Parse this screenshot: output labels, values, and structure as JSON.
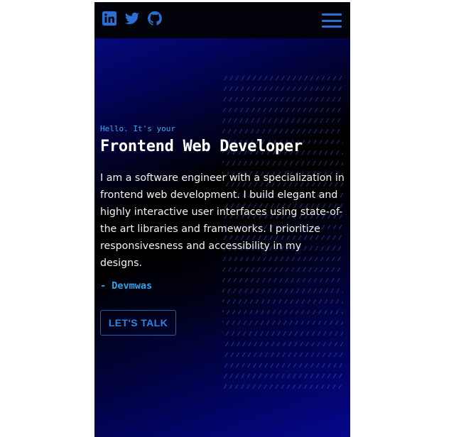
{
  "header": {
    "social_icons": [
      "linkedin-icon",
      "twitter-icon",
      "github-icon"
    ],
    "menu_icon": "hamburger-menu-icon"
  },
  "hero": {
    "greeting": "Hello. It's your",
    "title": "Frontend Web Developer",
    "bio": "I am a software engineer with a specialization in frontend web development. I build elegant and highly interactive user interfaces using state-of-the art libraries and frameworks. I prioritize responsivesness and accessibility in my designs.",
    "signature": "- Devmwas",
    "cta_label": "LET'S TALK"
  },
  "colors": {
    "accent": "#2a6fd1",
    "greeting": "#3ea8f0",
    "background_dark": "#000000",
    "background_blue": "#05068c"
  }
}
